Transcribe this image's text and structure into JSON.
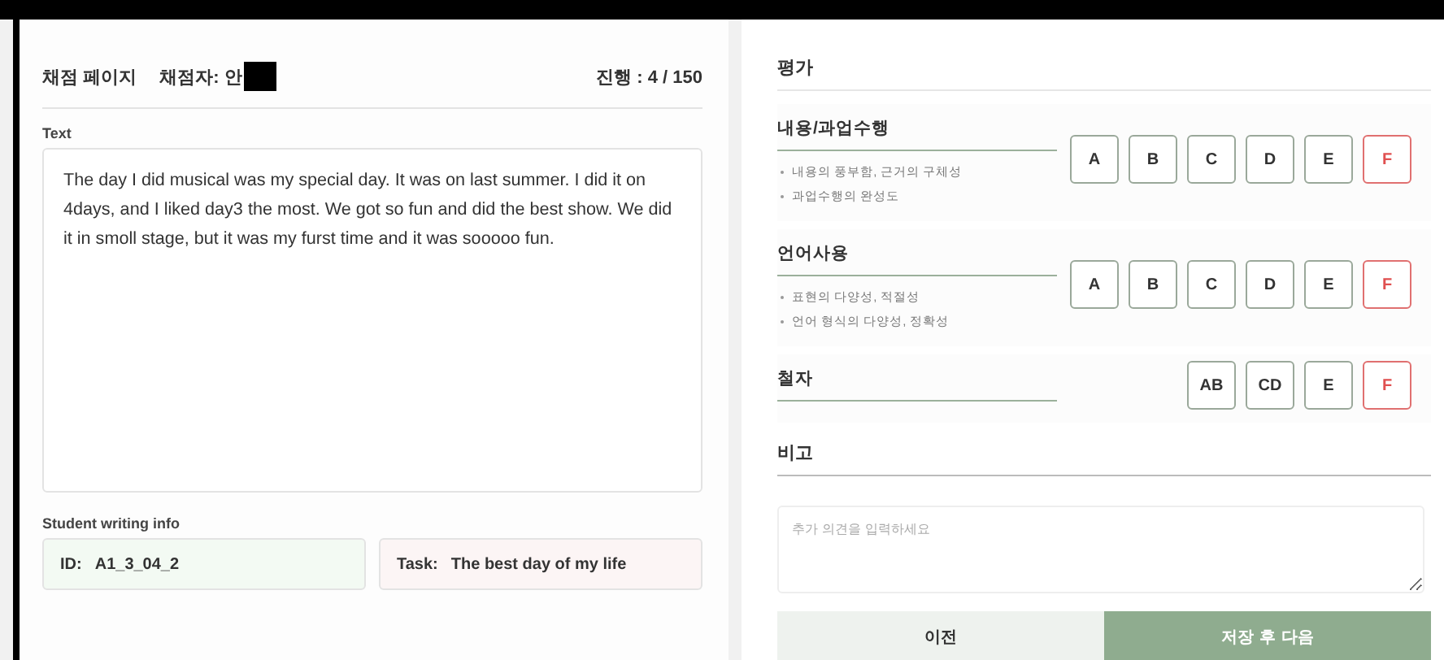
{
  "header": {
    "title": "채점 페이지",
    "grader": "채점자: 안",
    "grader_redacted": true,
    "progress": "진행 : 4 / 150"
  },
  "text_section": {
    "label": "Text",
    "body": "The day I did musical was my special day. It was on last summer. I did it on 4days, and I liked day3 the most. We got so fun and did the best show. We did it in smoll stage, but it was my furst time and it was sooooo fun."
  },
  "info": {
    "label": "Student writing info",
    "id_label": "ID:",
    "id_value": "A1_3_04_2",
    "task_label": "Task:",
    "task_value": "The best day of my life"
  },
  "evaluation": {
    "title": "평가",
    "criteria": [
      {
        "name": "내용/과업수행",
        "bullets": [
          "내용의 풍부함, 근거의 구체성",
          "과업수행의 완성도"
        ],
        "grades": [
          {
            "label": "A",
            "selected": false
          },
          {
            "label": "B",
            "selected": false
          },
          {
            "label": "C",
            "selected": false
          },
          {
            "label": "D",
            "selected": false
          },
          {
            "label": "E",
            "selected": false
          },
          {
            "label": "F",
            "selected": true
          }
        ]
      },
      {
        "name": "언어사용",
        "bullets": [
          "표현의 다양성, 적절성",
          "언어 형식의 다양성, 정확성"
        ],
        "grades": [
          {
            "label": "A",
            "selected": false
          },
          {
            "label": "B",
            "selected": false
          },
          {
            "label": "C",
            "selected": false
          },
          {
            "label": "D",
            "selected": false
          },
          {
            "label": "E",
            "selected": false
          },
          {
            "label": "F",
            "selected": true
          }
        ]
      },
      {
        "name": "철자",
        "grades": [
          {
            "label": "AB",
            "selected": false
          },
          {
            "label": "CD",
            "selected": false
          },
          {
            "label": "E",
            "selected": false
          },
          {
            "label": "F",
            "selected": true
          }
        ]
      }
    ]
  },
  "remarks": {
    "title": "비고",
    "placeholder": "추가 의견을 입력하세요"
  },
  "buttons": {
    "previous": "이전",
    "save_next": "저장 후 다음"
  }
}
